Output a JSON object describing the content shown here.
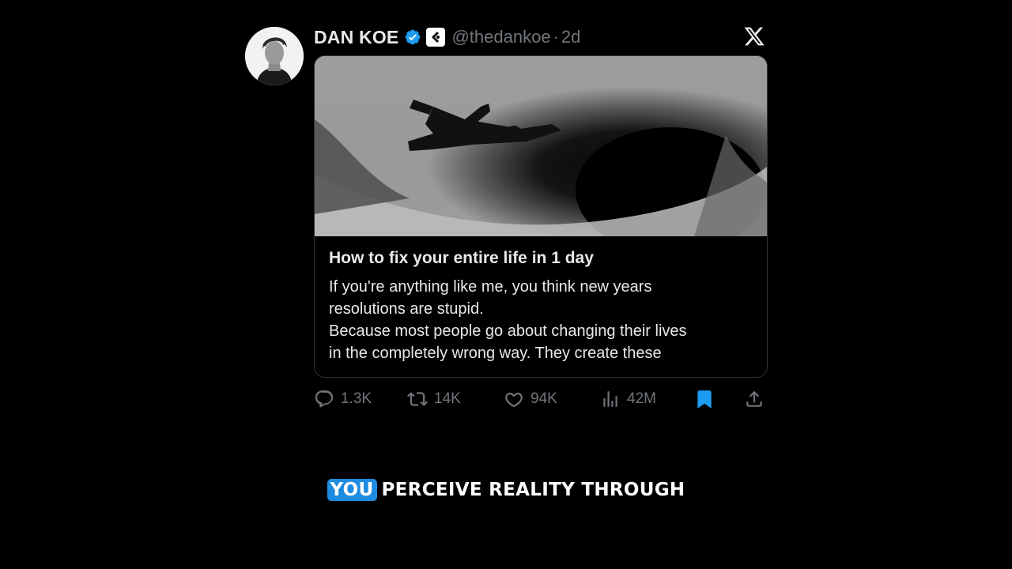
{
  "author": {
    "name": "DAN KOE",
    "handle": "@thedankoe",
    "separator": "·",
    "time": "2d"
  },
  "icons": {
    "verified": "verified-badge-icon",
    "affiliate": "affiliate-badge-icon",
    "platform": "x-logo-icon",
    "reply": "reply-icon",
    "retweet": "retweet-icon",
    "like": "heart-icon",
    "views": "views-icon",
    "bookmark": "bookmark-icon",
    "share": "share-icon"
  },
  "colors": {
    "verified": "#1d9bf0",
    "bookmark": "#1d9bf0",
    "caption_highlight": "#1d8ce0",
    "muted": "#71767b"
  },
  "article": {
    "title": "How to fix your entire life in 1 day",
    "lines": [
      "If you're anything like me, you think new years",
      "resolutions are stupid.",
      "Because most people go about changing their lives",
      "in the completely wrong way. They create these"
    ]
  },
  "stats": {
    "replies": "1.3K",
    "retweets": "14K",
    "likes": "94K",
    "views": "42M"
  },
  "caption": {
    "highlight": "YOU",
    "rest": "PERCEIVE REALITY THROUGH"
  }
}
